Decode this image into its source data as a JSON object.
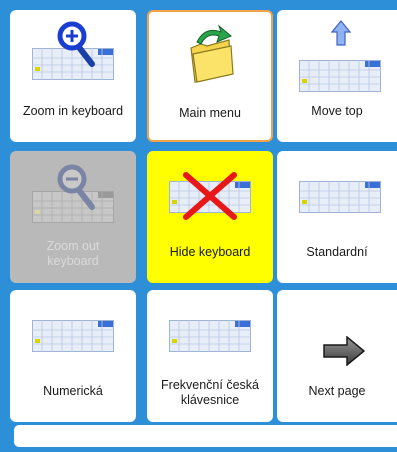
{
  "tiles": [
    {
      "label": "Zoom in keyboard",
      "icon": "zoom-in-icon",
      "state": "normal"
    },
    {
      "label": "Main menu",
      "icon": "folder-back-icon",
      "state": "selected"
    },
    {
      "label": "Move top",
      "icon": "arrow-up-icon",
      "state": "normal"
    },
    {
      "label": "Zoom out\nkeyboard",
      "icon": "zoom-out-icon",
      "state": "disabled"
    },
    {
      "label": "Hide keyboard",
      "icon": "red-x-icon",
      "state": "highlight"
    },
    {
      "label": "Standardní",
      "icon": "keyboard-icon",
      "state": "normal"
    },
    {
      "label": "Numerická",
      "icon": "keyboard-icon",
      "state": "normal"
    },
    {
      "label": "Frekvenční česká\nklávesnice",
      "icon": "keyboard-icon",
      "state": "normal"
    },
    {
      "label": "Next page",
      "icon": "arrow-right-icon",
      "state": "normal"
    }
  ],
  "colors": {
    "background": "#2d8fd8",
    "highlight": "#ffff00",
    "selected_border": "#f2a24a",
    "disabled": "#b9b9b9"
  }
}
